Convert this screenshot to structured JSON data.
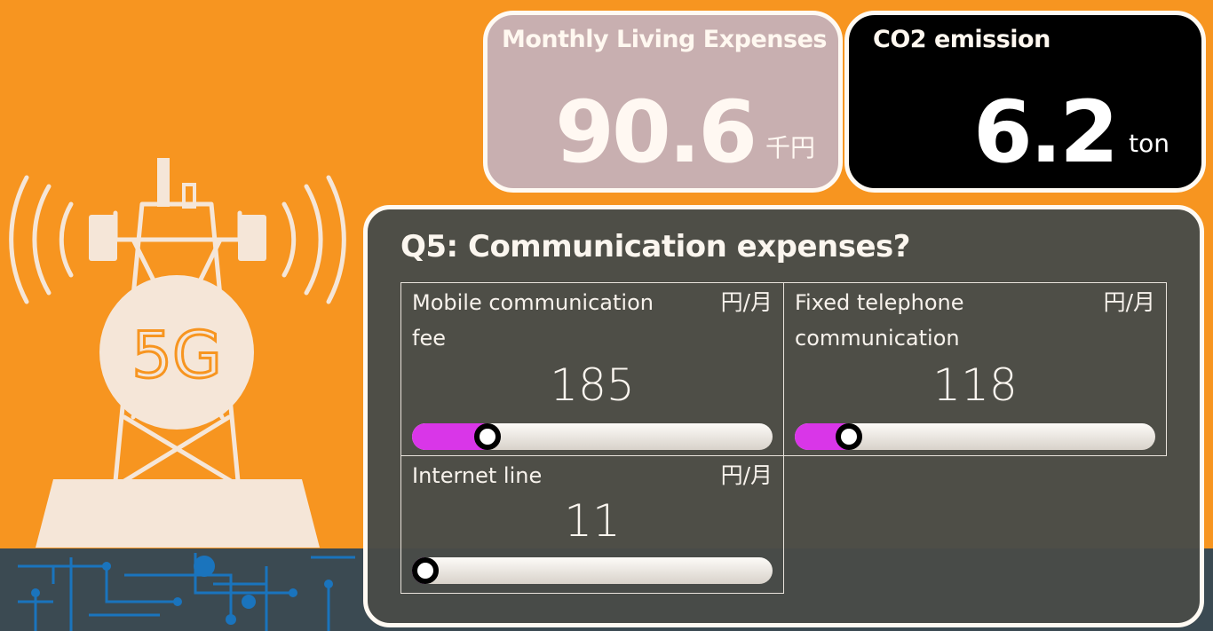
{
  "expenses_card": {
    "title": "Monthly Living Expenses",
    "value": "90.6",
    "unit": "千円"
  },
  "co2_card": {
    "title": "CO2 emission",
    "value": "6.2",
    "unit": "ton"
  },
  "question": {
    "title": "Q5:  Communication expenses?",
    "items": [
      {
        "label": "Mobile communication fee",
        "unit": "円/月",
        "value": "185",
        "slider_fraction": 0.21
      },
      {
        "label": "Fixed telephone communication",
        "unit": "円/月",
        "value": "118",
        "slider_fraction": 0.15
      },
      {
        "label": "Internet line",
        "unit": "円/月",
        "value": "11",
        "slider_fraction": 0.02
      }
    ]
  },
  "tower_badge": "5G",
  "colors": {
    "background": "#f79520",
    "slider_fill": "#d936e8",
    "panel": "#484b48"
  }
}
